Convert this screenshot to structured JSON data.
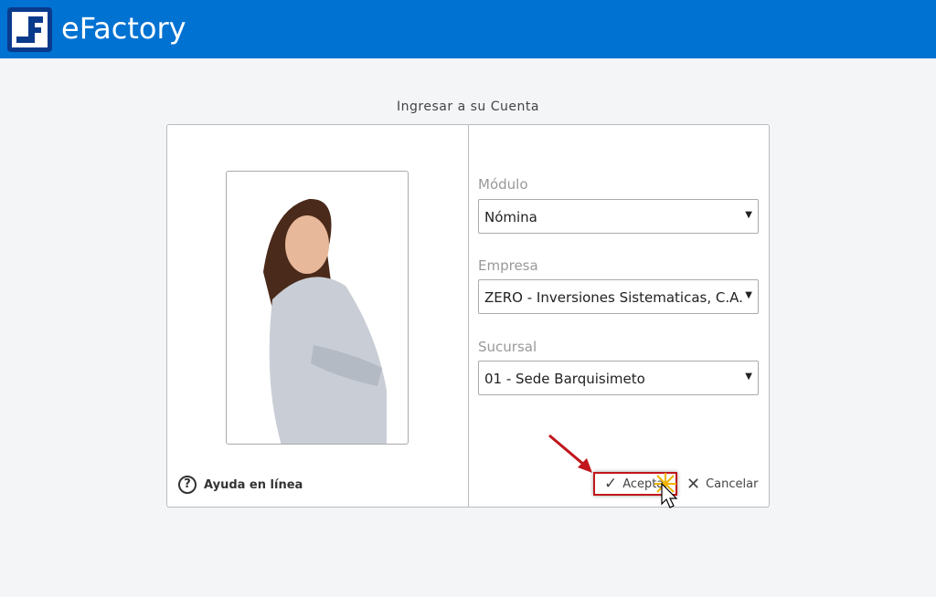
{
  "header": {
    "app_title": "eFactory"
  },
  "login": {
    "title": "Ingresar a su Cuenta",
    "help_label": "Ayuda en línea",
    "fields": [
      {
        "label": "Módulo",
        "value": "Nómina"
      },
      {
        "label": "Empresa",
        "value": "ZERO - Inversiones Sistematicas, C.A."
      },
      {
        "label": "Sucursal",
        "value": "01 - Sede Barquisimeto"
      }
    ],
    "accept_label": "Aceptar",
    "cancel_label": "Cancelar"
  },
  "colors": {
    "header": "#0072d2",
    "annotation": "#c0161c"
  }
}
